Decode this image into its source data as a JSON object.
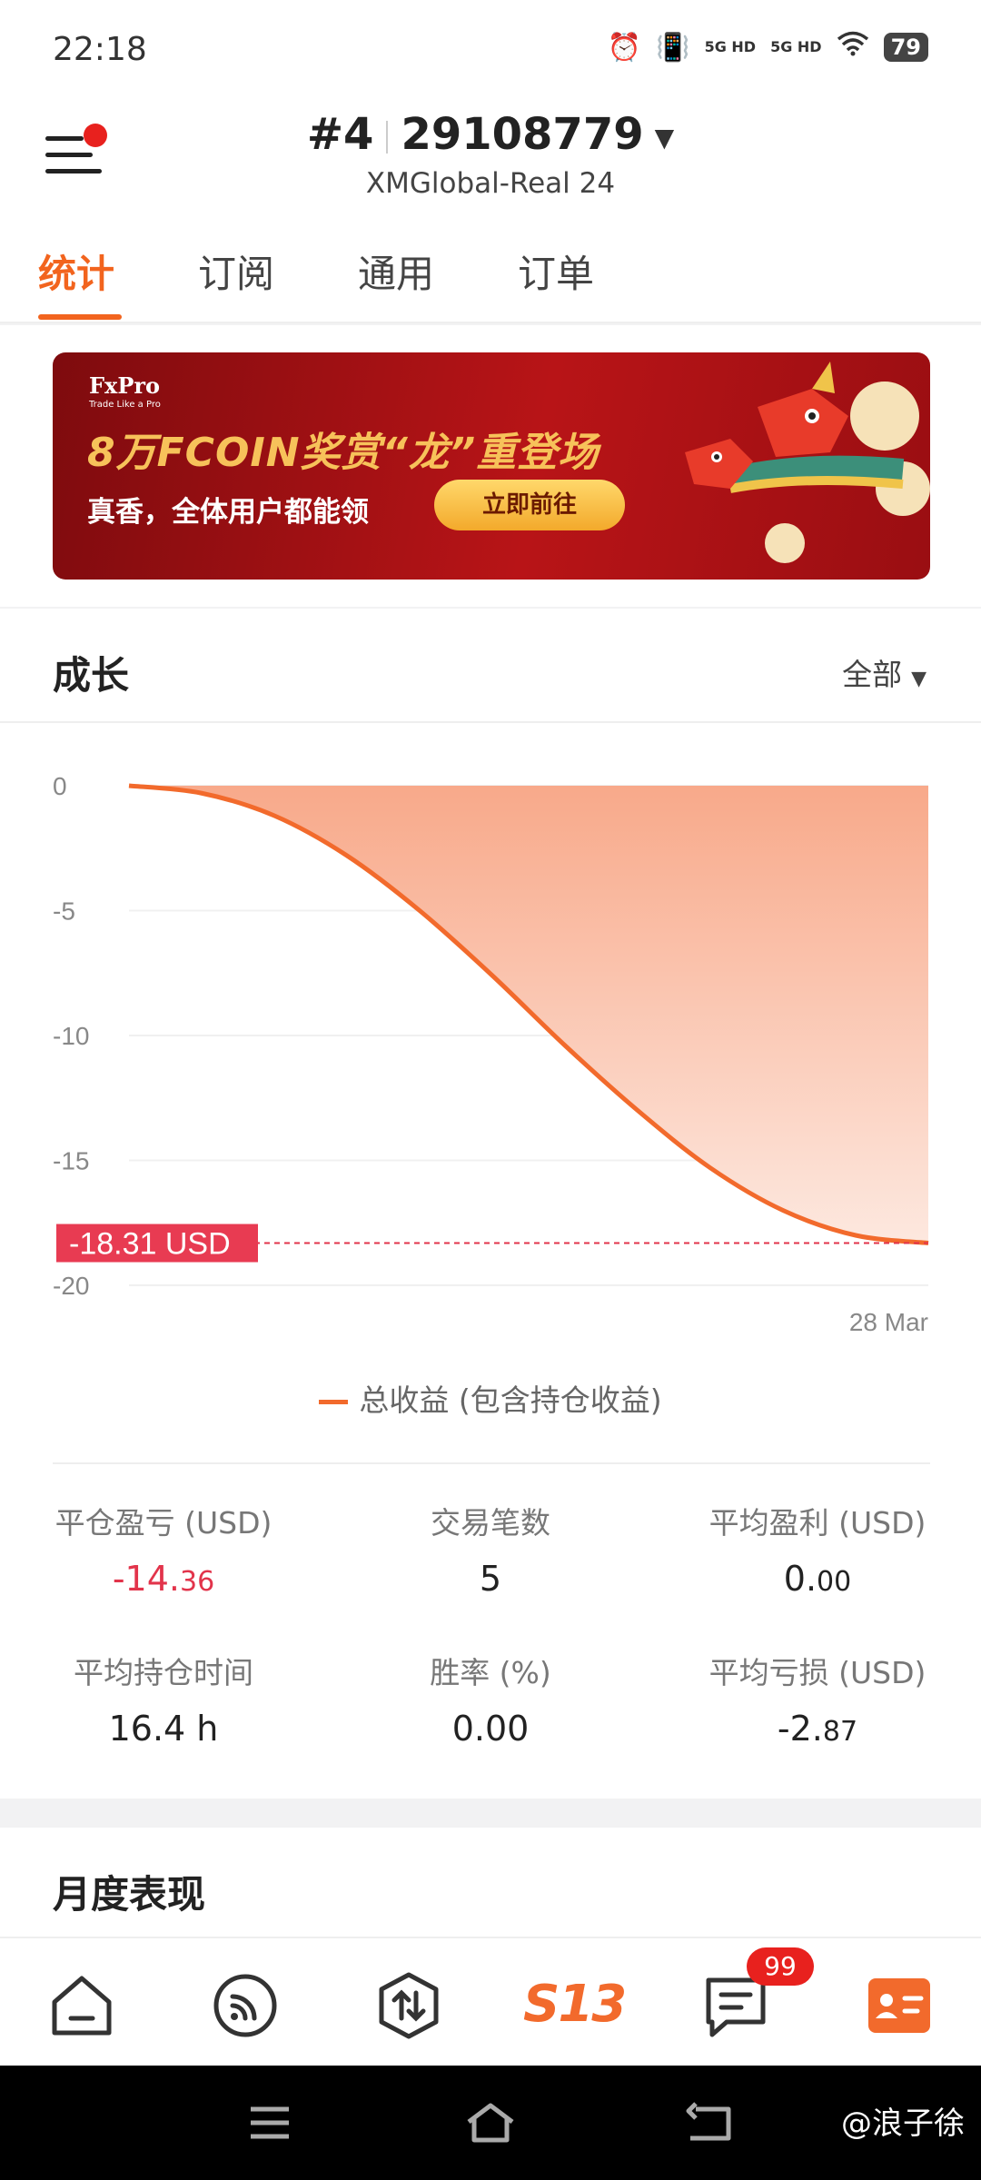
{
  "status_bar": {
    "time": "22:18",
    "net1": "5G HD",
    "net2": "5G HD",
    "battery": "79"
  },
  "header": {
    "account_prefix": "#4",
    "account_number": "29108779",
    "server": "XMGlobal-Real 24"
  },
  "tabs": [
    {
      "label": "统计"
    },
    {
      "label": "订阅"
    },
    {
      "label": "通用"
    },
    {
      "label": "订单"
    }
  ],
  "banner": {
    "brand": "FxPro",
    "brand_sub": "Trade Like a Pro",
    "title": "8万FCOIN奖赏“龙”重登场",
    "text": "真香，全体用户都能领",
    "button": "立即前往"
  },
  "growth": {
    "title": "成长",
    "filter": "全部"
  },
  "chart_data": {
    "type": "area",
    "y_ticks": [
      "0",
      "-5",
      "-10",
      "-15",
      "-20"
    ],
    "ylim": [
      -20,
      0
    ],
    "x_labels": [
      "28 Mar"
    ],
    "series": [
      {
        "name": "总收益 (包含持仓收益)",
        "color": "#f26a2c",
        "values": [
          0,
          -0.3,
          -1.2,
          -2.8,
          -5.0,
          -7.6,
          -10.4,
          -13.0,
          -15.3,
          -17.0,
          -18.0,
          -18.31
        ]
      }
    ],
    "current_label": "-18.31 USD",
    "current_value": -18.31
  },
  "legend": {
    "label": "总收益 (包含持仓收益)"
  },
  "stats": [
    {
      "label": "平仓盈亏 (USD)",
      "int": "-14.",
      "dec": "36",
      "negative": true
    },
    {
      "label": "交易笔数",
      "int": "5",
      "dec": "",
      "negative": false
    },
    {
      "label": "平均盈利 (USD)",
      "int": "0.",
      "dec": "00",
      "negative": false
    },
    {
      "label": "平均持仓时间",
      "int": "16.4 h",
      "dec": "",
      "negative": false
    },
    {
      "label": "胜率 (%)",
      "int": "0.00",
      "dec": "",
      "negative": false
    },
    {
      "label": "平均亏损 (USD)",
      "int": "-2.",
      "dec": "87",
      "negative": false
    }
  ],
  "monthly": {
    "title": "月度表现"
  },
  "bottom_nav": {
    "badge": "99",
    "s13": "S13"
  },
  "watermark": "@浪子徐"
}
